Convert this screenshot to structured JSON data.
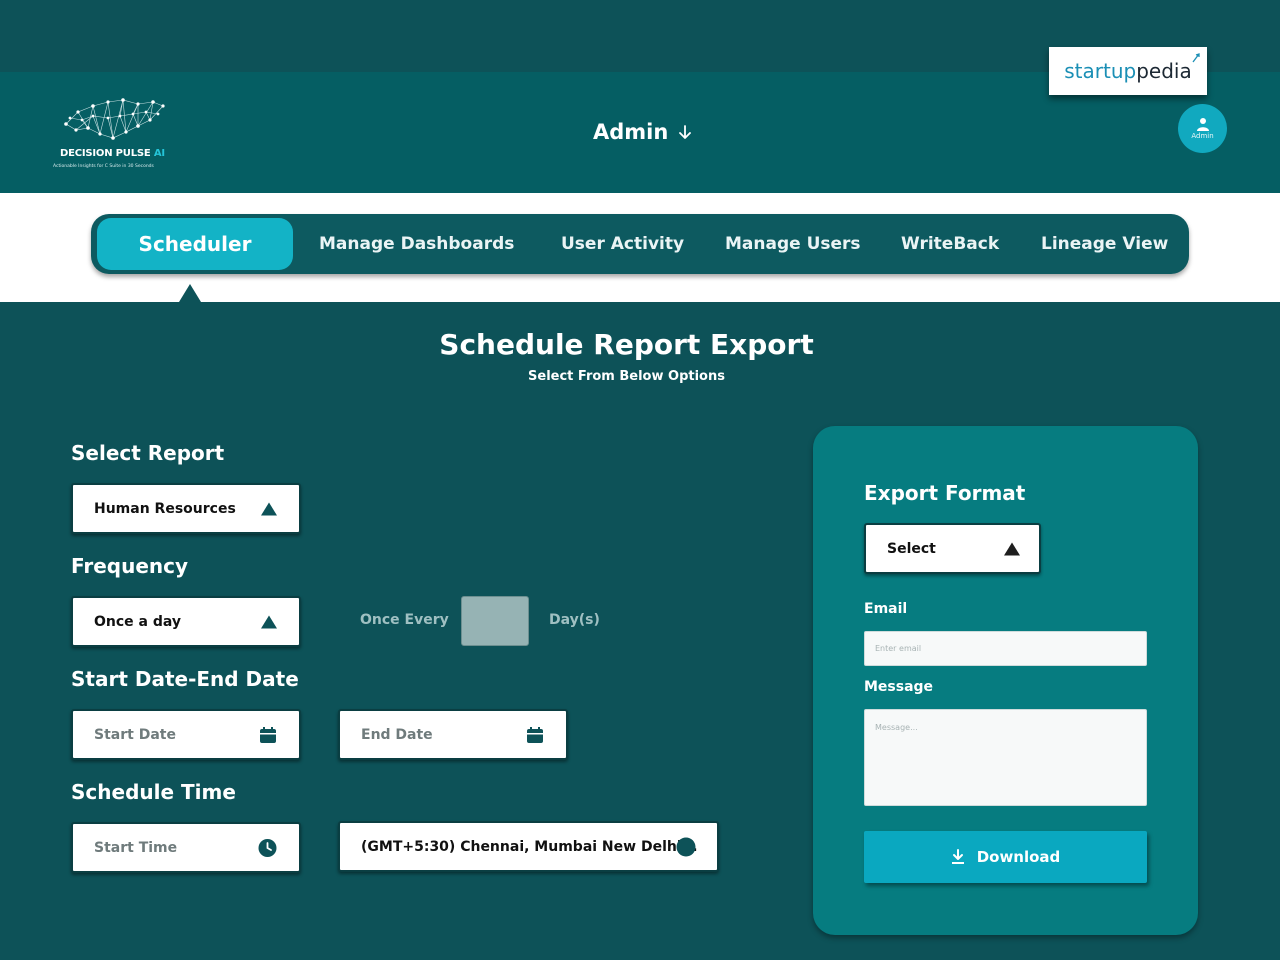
{
  "header": {
    "logo": {
      "brand_main": "DECISION PULSE",
      "brand_ai": "AI",
      "tagline": "Actionable Insights for C Suite in 30 Seconds"
    },
    "role_title": "Admin",
    "role_arrow_icon": "arrow-down-icon",
    "partner_logo": {
      "part1": "startup",
      "part2": "pedia"
    },
    "avatar_label": "Admin"
  },
  "nav": {
    "tabs": [
      {
        "label": "Scheduler",
        "active": true
      },
      {
        "label": "Manage Dashboards",
        "active": false
      },
      {
        "label": "User Activity",
        "active": false
      },
      {
        "label": "Manage Users",
        "active": false
      },
      {
        "label": "WriteBack",
        "active": false
      },
      {
        "label": "Lineage View",
        "active": false
      }
    ]
  },
  "page": {
    "title": "Schedule Report Export",
    "subtitle": "Select From Below Options"
  },
  "form": {
    "report": {
      "label": "Select Report",
      "value": "Human Resources"
    },
    "frequency": {
      "label": "Frequency",
      "value": "Once a day",
      "once_every_label": "Once Every",
      "days_value": "",
      "days_unit": "Day(s)"
    },
    "dates": {
      "label": "Start Date-End Date",
      "start_placeholder": "Start Date",
      "end_placeholder": "End Date"
    },
    "time": {
      "label": "Schedule Time",
      "start_placeholder": "Start Time",
      "timezone_value": "(GMT+5:30) Chennai, Mumbai New Delhi..."
    }
  },
  "export_panel": {
    "title": "Export Format",
    "format_value": "Select",
    "email_label": "Email",
    "email_placeholder": "Enter email",
    "message_label": "Message",
    "message_placeholder": "Message...",
    "download_label": "Download"
  },
  "colors": {
    "background": "#0d5258",
    "header": "#055e63",
    "accent": "#13b3c6",
    "panel": "#067c80",
    "download_button": "#0aa8c0"
  }
}
